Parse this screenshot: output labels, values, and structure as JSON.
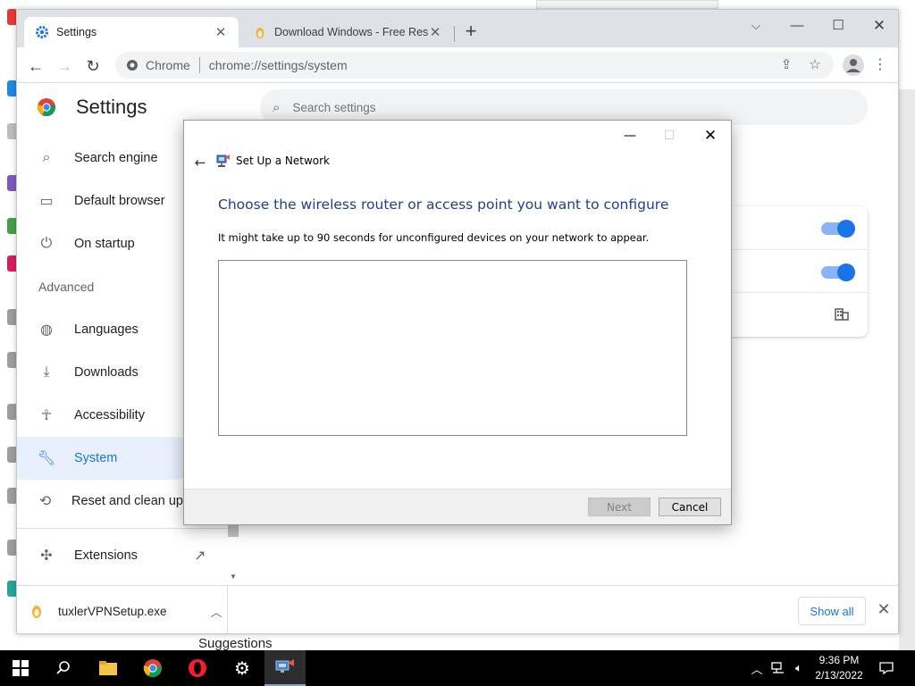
{
  "chrome": {
    "tabs": [
      {
        "title": "Settings",
        "icon": "gear-icon",
        "active": true
      },
      {
        "title": "Download Windows - Free Resid",
        "icon": "tuxler-icon",
        "active": false
      }
    ],
    "address": {
      "site": "Chrome",
      "url": "chrome://settings/system"
    }
  },
  "settings": {
    "title": "Settings",
    "search_placeholder": "Search settings",
    "nav": [
      {
        "label": "Search engine",
        "icon": "search-icon"
      },
      {
        "label": "Default browser",
        "icon": "browser-icon"
      },
      {
        "label": "On startup",
        "icon": "power-icon"
      }
    ],
    "advanced_heading": "Advanced",
    "advanced_nav": [
      {
        "label": "Languages",
        "icon": "globe-icon"
      },
      {
        "label": "Downloads",
        "icon": "download-icon"
      },
      {
        "label": "Accessibility",
        "icon": "accessibility-icon"
      },
      {
        "label": "System",
        "icon": "wrench-icon",
        "selected": true
      },
      {
        "label": "Reset and clean up",
        "icon": "history-icon"
      }
    ],
    "extensions_label": "Extensions",
    "accent_color": "#1a73e8"
  },
  "downloads": {
    "file_name": "tuxlerVPNSetup.exe",
    "show_all_label": "Show all"
  },
  "dialog": {
    "title": "Set Up a Network",
    "heading": "Choose the wireless router or access point you want to configure",
    "subtext": "It might take up to 90 seconds for unconfigured devices on your network to appear.",
    "next_label": "Next",
    "cancel_label": "Cancel"
  },
  "desktop": {
    "suggestions_text": "Suggestions"
  },
  "taskbar": {
    "time": "9:36 PM",
    "date": "2/13/2022"
  }
}
